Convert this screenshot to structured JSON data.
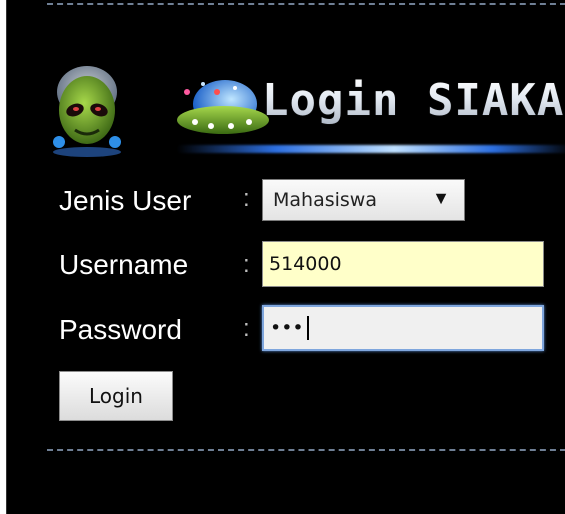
{
  "header": {
    "title": "Login SIAKAD"
  },
  "form": {
    "user_type_label": "Jenis User",
    "username_label": "Username",
    "password_label": "Password",
    "colon": ":",
    "user_type_value": "Mahasiswa",
    "username_value": "514000",
    "password_mask": "•••",
    "login_button": "Login"
  },
  "icons": {
    "alien": "alien-mascot-icon",
    "ufo": "ufo-icon",
    "dropdown": "triangle-down-icon"
  },
  "colors": {
    "background": "#000000",
    "username_field": "#ffffc9",
    "password_focus": "#7fa6dd"
  }
}
